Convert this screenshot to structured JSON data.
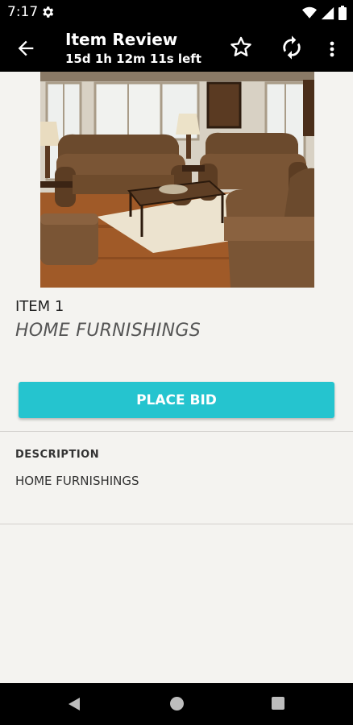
{
  "status_bar": {
    "time": "7:17"
  },
  "app_bar": {
    "title": "Item Review",
    "subtitle": "15d 1h 12m 11s left"
  },
  "item": {
    "name": "ITEM 1",
    "category": "HOME FURNISHINGS",
    "photo_icon": "living-room-furniture-photo"
  },
  "actions": {
    "place_bid_label": "PLACE BID"
  },
  "description": {
    "label": "DESCRIPTION",
    "text": "HOME FURNISHINGS"
  },
  "colors": {
    "accent": "#25c4cf",
    "bars": "#000000",
    "background": "#f4f3f0"
  }
}
